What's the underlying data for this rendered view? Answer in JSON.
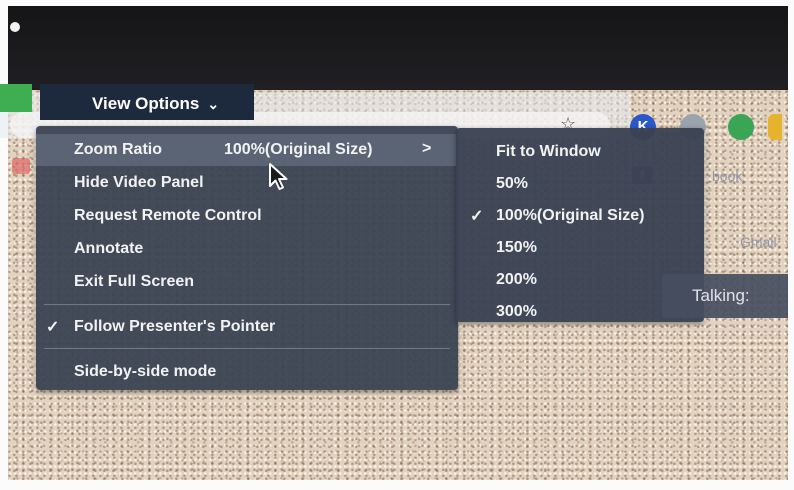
{
  "view_options": {
    "label": "View Options",
    "chevron": "⌄"
  },
  "menu": {
    "items": [
      {
        "label": "Zoom Ratio",
        "value": "100%(Original Size)",
        "has_submenu": true
      },
      {
        "label": "Hide Video Panel"
      },
      {
        "label": "Request Remote Control"
      },
      {
        "label": "Annotate"
      },
      {
        "label": "Exit Full Screen"
      },
      {
        "label": "Follow Presenter's Pointer",
        "checked": true
      },
      {
        "label": "Side-by-side mode"
      }
    ],
    "arrow": ">",
    "check": "✓"
  },
  "submenu": {
    "items": [
      {
        "label": "Fit to Window"
      },
      {
        "label": "50%"
      },
      {
        "label": "100%(Original Size)",
        "checked": true
      },
      {
        "label": "150%"
      },
      {
        "label": "200%"
      },
      {
        "label": "300%"
      }
    ]
  },
  "talking": {
    "label": "Talking:"
  },
  "background": {
    "facebook_text": "book",
    "gmail_text": "Gmail",
    "extension_letter": "K",
    "fb_letter": "f"
  },
  "icons": {
    "star": "star-icon",
    "cursor": "mouse-pointer-icon"
  },
  "colors": {
    "menu_bg": "#3a4252",
    "highlight": "#5a6474",
    "view_options_bg": "#1d2a3d",
    "text": "#f2f2f2"
  }
}
